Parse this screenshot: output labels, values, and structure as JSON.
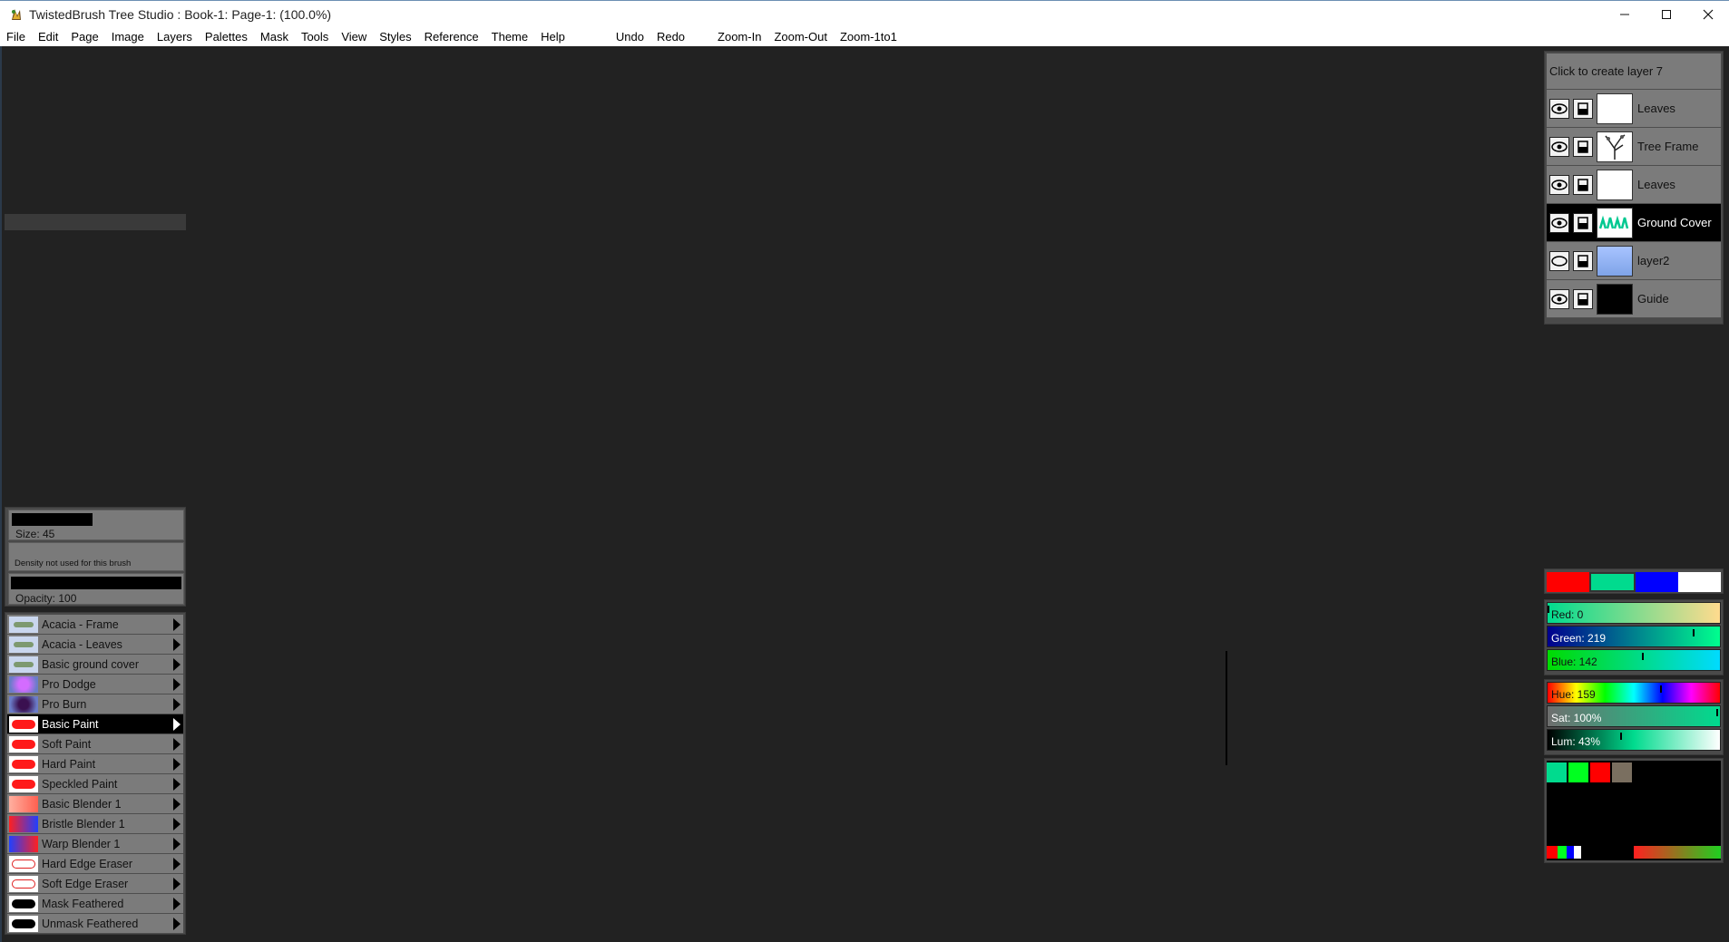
{
  "window": {
    "title": "TwistedBrush Tree Studio : Book-1: Page-1:  (100.0%)",
    "app_icon": "twistedbrush-logo-icon",
    "controls": [
      "minimize-icon",
      "maximize-icon",
      "close-icon"
    ]
  },
  "menu": {
    "items": [
      "File",
      "Edit",
      "Page",
      "Image",
      "Layers",
      "Palettes",
      "Mask",
      "Tools",
      "View",
      "Styles",
      "Reference",
      "Theme",
      "Help"
    ],
    "actions": [
      "Undo",
      "Redo"
    ],
    "zoom": [
      "Zoom-In",
      "Zoom-Out",
      "Zoom-1to1"
    ]
  },
  "brush_controls": {
    "size_label": "Size: 45",
    "size_value": 45,
    "density_label": "Density not used for this brush",
    "opacity_label": "Opacity: 100",
    "opacity_value": 100
  },
  "brushes": [
    {
      "name": "Acacia - Frame",
      "icon": "acacia-frame-brush-icon",
      "selected": false
    },
    {
      "name": "Acacia - Leaves",
      "icon": "acacia-leaves-brush-icon",
      "selected": false
    },
    {
      "name": "Basic ground cover",
      "icon": "ground-cover-brush-icon",
      "selected": false
    },
    {
      "name": "Pro Dodge",
      "icon": "dodge-brush-icon",
      "selected": false
    },
    {
      "name": "Pro Burn",
      "icon": "burn-brush-icon",
      "selected": false
    },
    {
      "name": "Basic Paint",
      "icon": "paint-brush-icon",
      "selected": true
    },
    {
      "name": "Soft Paint",
      "icon": "soft-paint-brush-icon",
      "selected": false
    },
    {
      "name": "Hard Paint",
      "icon": "hard-paint-brush-icon",
      "selected": false
    },
    {
      "name": "Speckled Paint",
      "icon": "speckled-brush-icon",
      "selected": false
    },
    {
      "name": "Basic Blender 1",
      "icon": "blender-brush-icon",
      "selected": false
    },
    {
      "name": "Bristle Blender 1",
      "icon": "bristle-blender-brush-icon",
      "selected": false
    },
    {
      "name": "Warp Blender 1",
      "icon": "warp-blender-brush-icon",
      "selected": false
    },
    {
      "name": "Hard Edge Eraser",
      "icon": "hard-eraser-brush-icon",
      "selected": false
    },
    {
      "name": "Soft Edge Eraser",
      "icon": "soft-eraser-brush-icon",
      "selected": false
    },
    {
      "name": "Mask Feathered",
      "icon": "mask-brush-icon",
      "selected": false
    },
    {
      "name": "Unmask Feathered",
      "icon": "unmask-brush-icon",
      "selected": false
    }
  ],
  "layers": {
    "create_label": "Click to create layer 7",
    "items": [
      {
        "name": "Leaves",
        "thumb": "white",
        "visible": true,
        "selected": false
      },
      {
        "name": "Tree Frame",
        "thumb": "tree",
        "visible": true,
        "selected": false
      },
      {
        "name": "Leaves",
        "thumb": "white",
        "visible": true,
        "selected": false
      },
      {
        "name": "Ground Cover",
        "thumb": "ground",
        "visible": true,
        "selected": true
      },
      {
        "name": "layer2",
        "thumb": "blue",
        "visible": false,
        "selected": false
      },
      {
        "name": "Guide",
        "thumb": "black",
        "visible": true,
        "selected": false
      }
    ]
  },
  "colors": {
    "swatches": [
      "#ff0000",
      "#00db8e",
      "#0000ff",
      "#ffffff"
    ],
    "selected_swatch": 1,
    "red_label": "Red: 0",
    "green_label": "Green: 219",
    "blue_label": "Blue: 142",
    "hue_label": "Hue: 159",
    "sat_label": "Sat: 100%",
    "lum_label": "Lum: 43%",
    "red": 0,
    "green": 219,
    "blue": 142,
    "hue": 159,
    "sat": 100,
    "lum": 43,
    "palette": [
      "#00db8e",
      "#00ff20",
      "#ff0000",
      "#7a6f60"
    ]
  }
}
